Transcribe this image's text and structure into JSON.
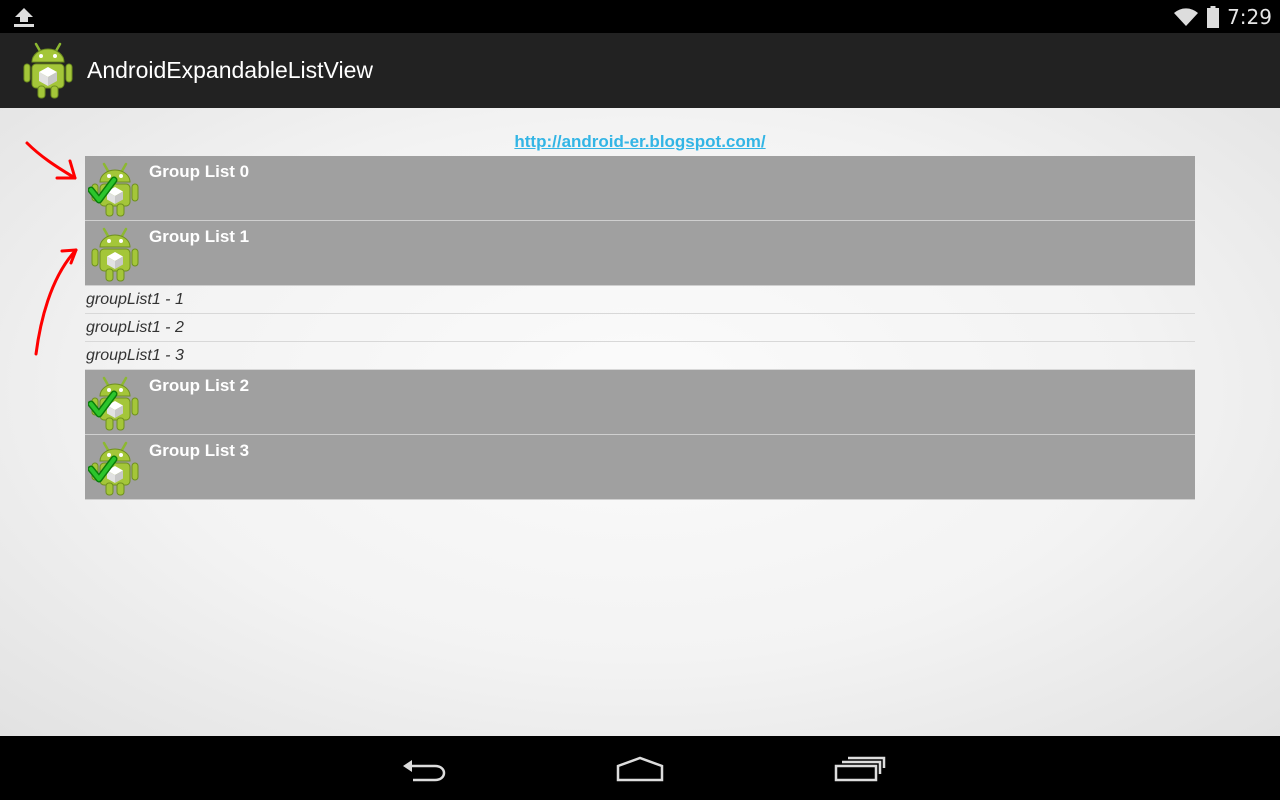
{
  "status_bar": {
    "time": "7:29",
    "icons": [
      "upload-icon",
      "wifi-icon",
      "battery-icon"
    ]
  },
  "action_bar": {
    "title": "AndroidExpandableListView",
    "icon": "android-app-icon"
  },
  "content": {
    "link": "http://android-er.blogspot.com/",
    "groups": [
      {
        "label": "Group List 0",
        "checked": true,
        "expanded": false,
        "children": []
      },
      {
        "label": "Group List 1",
        "checked": false,
        "expanded": true,
        "children": [
          "groupList1 - 1",
          "groupList1 - 2",
          "groupList1 - 3"
        ]
      },
      {
        "label": "Group List 2",
        "checked": true,
        "expanded": false,
        "children": []
      },
      {
        "label": "Group List 3",
        "checked": true,
        "expanded": false,
        "children": []
      }
    ]
  },
  "nav_bar": {
    "buttons": [
      "back-icon",
      "home-icon",
      "recents-icon"
    ]
  },
  "colors": {
    "group_background": "#a0a0a0",
    "link": "#33b5e5",
    "action_bar": "#222222",
    "annotation": "#ff0000",
    "check": "#2cc52c"
  }
}
